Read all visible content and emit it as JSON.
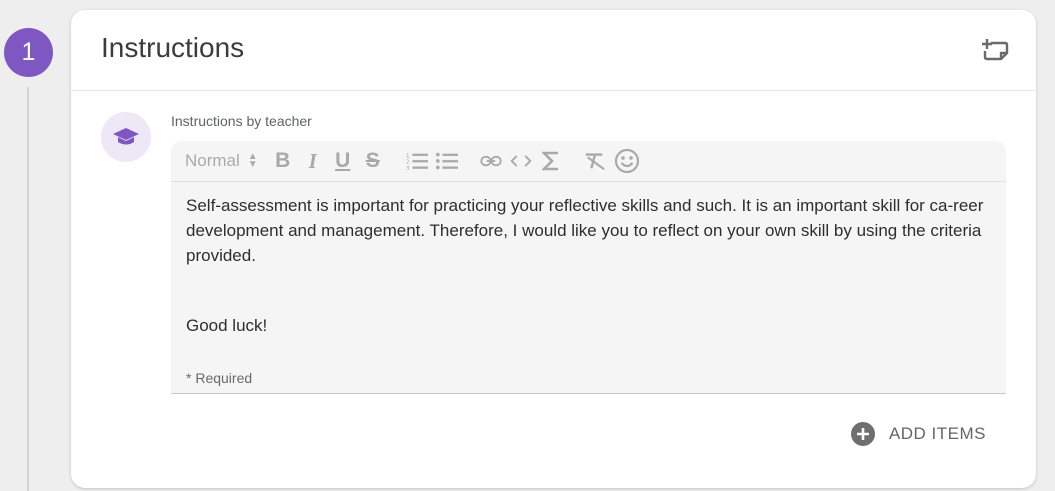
{
  "step": {
    "number": "1"
  },
  "card": {
    "title": "Instructions"
  },
  "instructions": {
    "caption": "Instructions by teacher",
    "format_select": "Normal",
    "paragraphs": [
      "Self-assessment is important for practicing your reflective skills and such. It is an important skill for ca-reer development and management. Therefore, I would like you to reflect on your own skill by using the criteria provided.",
      "Good luck!"
    ],
    "required_note": "* Required"
  },
  "toolbar_icons": [
    "bold-icon",
    "italic-icon",
    "underline-icon",
    "strikethrough-icon",
    "ordered-list-icon",
    "bullet-list-icon",
    "link-icon",
    "code-icon",
    "formula-icon",
    "clear-format-icon",
    "emoji-icon"
  ],
  "actions": {
    "add_items": "ADD ITEMS"
  },
  "colors": {
    "accent": "#7e57c2",
    "avatar_bg": "#ede7f6",
    "icon_gray": "#a9a9a9"
  }
}
